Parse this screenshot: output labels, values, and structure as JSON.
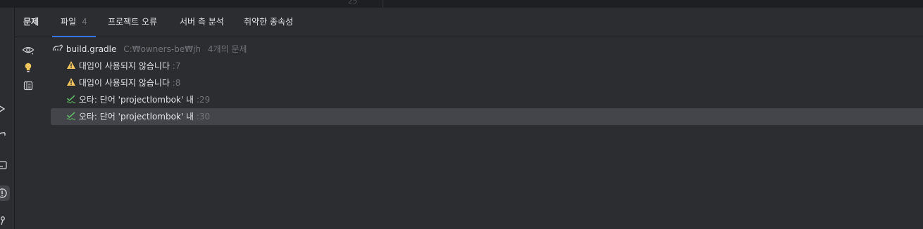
{
  "editor": {
    "line_number": "25"
  },
  "tabs": [
    {
      "label": "문제",
      "count": ""
    },
    {
      "label": "파일",
      "count": "4"
    },
    {
      "label": "프로젝트 오류",
      "count": ""
    },
    {
      "label": "서버 측 분석",
      "count": ""
    },
    {
      "label": "취약한 종속성",
      "count": ""
    }
  ],
  "file": {
    "name": "build.gradle",
    "path": "C:₩owners-be₩jh",
    "problem_count": "4개의 문제"
  },
  "problems": [
    {
      "icon": "warning-icon",
      "text": "대입이 사용되지 않습니다",
      "line": ":7"
    },
    {
      "icon": "warning-icon",
      "text": "대입이 사용되지 않습니다",
      "line": ":8"
    },
    {
      "icon": "typo-icon",
      "text": "오타: 단어 'projectlombok' 내",
      "line": ":29"
    },
    {
      "icon": "typo-icon",
      "text": "오타: 단어 'projectlombok' 내",
      "line": ":30"
    }
  ],
  "colors": {
    "background": "#2b2d30",
    "selection": "#43454a",
    "accent": "#3574f0",
    "warning": "#f2c55c",
    "typo": "#5fb865",
    "lightbulb": "#f2c55c"
  }
}
